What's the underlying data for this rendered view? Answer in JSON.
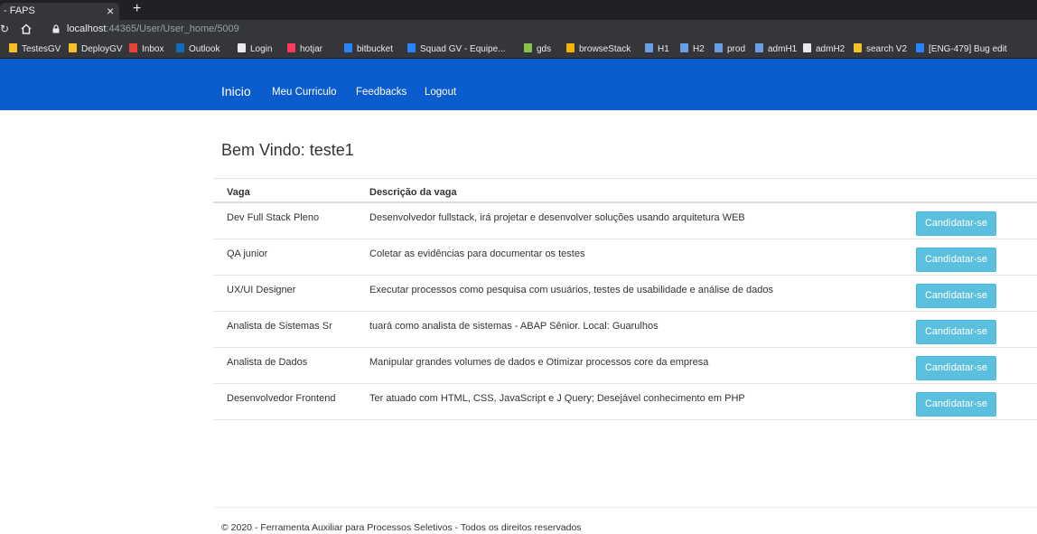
{
  "browser": {
    "tab_title": "- FAPS",
    "tab_close": "×",
    "new_tab": "+",
    "reload": "↻",
    "url_host": "localhost",
    "url_path": ":44365/User/User_home/5009",
    "bookmarks": [
      {
        "label": "TestesGV",
        "icon": "folder-icon",
        "color": "#f6c026"
      },
      {
        "label": "DeployGV",
        "icon": "folder-icon",
        "color": "#f6c026"
      },
      {
        "label": "Inbox",
        "icon": "gmail-icon",
        "color": "#ea4335"
      },
      {
        "label": "Outlook",
        "icon": "outlook-icon",
        "color": "#0f6cbd"
      },
      {
        "label": "Login",
        "icon": "globe-icon",
        "color": "#e8eaed"
      },
      {
        "label": "hotjar",
        "icon": "hotjar-icon",
        "color": "#fd3a5c"
      },
      {
        "label": "bitbucket",
        "icon": "bitbucket-icon",
        "color": "#2684ff"
      },
      {
        "label": "Squad GV - Equipe...",
        "icon": "jira-icon",
        "color": "#2684ff"
      },
      {
        "label": "gds",
        "icon": "gds-icon",
        "color": "#8bc34a"
      },
      {
        "label": "browseStack",
        "icon": "browserstack-icon",
        "color": "#f4b400"
      },
      {
        "label": "H1",
        "icon": "flag-icon",
        "color": "#6a9fe8"
      },
      {
        "label": "H2",
        "icon": "flag-icon",
        "color": "#6a9fe8"
      },
      {
        "label": "prod",
        "icon": "flag-icon",
        "color": "#6a9fe8"
      },
      {
        "label": "admH1",
        "icon": "flag-icon",
        "color": "#6a9fe8"
      },
      {
        "label": "admH2",
        "icon": "globe-icon",
        "color": "#e8eaed"
      },
      {
        "label": "search V2",
        "icon": "folder-icon",
        "color": "#f6c026"
      },
      {
        "label": "[ENG-479] Bug edit",
        "icon": "jira-icon",
        "color": "#2684ff"
      }
    ]
  },
  "navbar": {
    "brand": "Inicio",
    "links": [
      "Meu Curriculo",
      "Feedbacks",
      "Logout"
    ],
    "color": "#0a5ccf"
  },
  "welcome": {
    "prefix": "Bem Vindo: ",
    "user": "teste1"
  },
  "table": {
    "headers": [
      "Vaga",
      "Descrição da vaga"
    ],
    "button_label": "Candidatar-se",
    "button_color": "#5bc0de",
    "rows": [
      {
        "vaga": "Dev Full Stack Pleno",
        "descricao": "Desenvolvedor fullstack, irá projetar e desenvolver soluções usando arquitetura WEB"
      },
      {
        "vaga": "QA junior",
        "descricao": "Coletar as evidências para documentar os testes"
      },
      {
        "vaga": "UX/UI Designer",
        "descricao": "Executar processos como pesquisa com usuários, testes de usabilidade e análise de dados"
      },
      {
        "vaga": "Analista de Sistemas Sr",
        "descricao": "tuará como analista de sistemas - ABAP Sênior. Local: Guarulhos"
      },
      {
        "vaga": "Analista de Dados",
        "descricao": "Manipular grandes volumes de dados e Otimizar processos core da empresa"
      },
      {
        "vaga": "Desenvolvedor Frontend",
        "descricao": "Ter atuado com HTML, CSS, JavaScript e J Query; Desejável conhecimento em PHP"
      }
    ]
  },
  "footer": {
    "text": "© 2020 - Ferramenta Auxiliar para Processos Seletivos - Todos os direitos reservados"
  }
}
